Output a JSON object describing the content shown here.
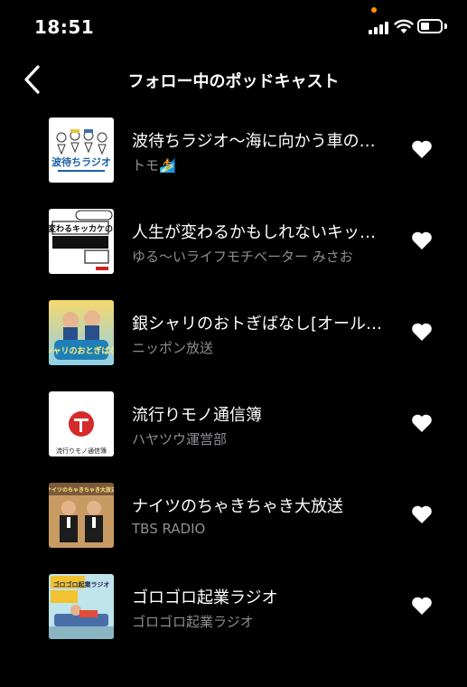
{
  "status_bar": {
    "time": "18:51"
  },
  "header": {
    "title": "フォロー中のポッドキャスト",
    "back_icon": "chevron-left-icon"
  },
  "colors": {
    "background": "#000000",
    "text_primary": "#ffffff",
    "text_secondary": "#8e8e93",
    "privacy_indicator": "#ff9500"
  },
  "podcasts": [
    {
      "title": "波待ちラジオ〜海に向かう車の中で〜",
      "subtitle": "トモ🏄",
      "followed": true,
      "artwork_text": "波待ちラジオ"
    },
    {
      "title": "人生が変わるかもしれないキッカケのお話",
      "subtitle": "ゆる〜いライフモチベーター みさお",
      "followed": true,
      "artwork_text": "人生変わるキッカケのお話"
    },
    {
      "title": "銀シャリのおトぎばなし[オールナイトニッポンPODCAST]",
      "subtitle": "ニッポン放送",
      "followed": true,
      "artwork_text": "銀シャリのおとぎばなし"
    },
    {
      "title": "流行りモノ通信簿",
      "subtitle": "ハヤツウ運営部",
      "followed": true,
      "artwork_text": "流行りモノ通信簿"
    },
    {
      "title": "ナイツのちゃきちゃき大放送",
      "subtitle": "TBS RADIO",
      "followed": true,
      "artwork_text": "ナイツのちゃきちゃき大放送"
    },
    {
      "title": "ゴロゴロ起業ラジオ",
      "subtitle": "ゴロゴロ起業ラジオ",
      "followed": true,
      "artwork_text": "ゴロゴロ起業ラジオ"
    }
  ]
}
